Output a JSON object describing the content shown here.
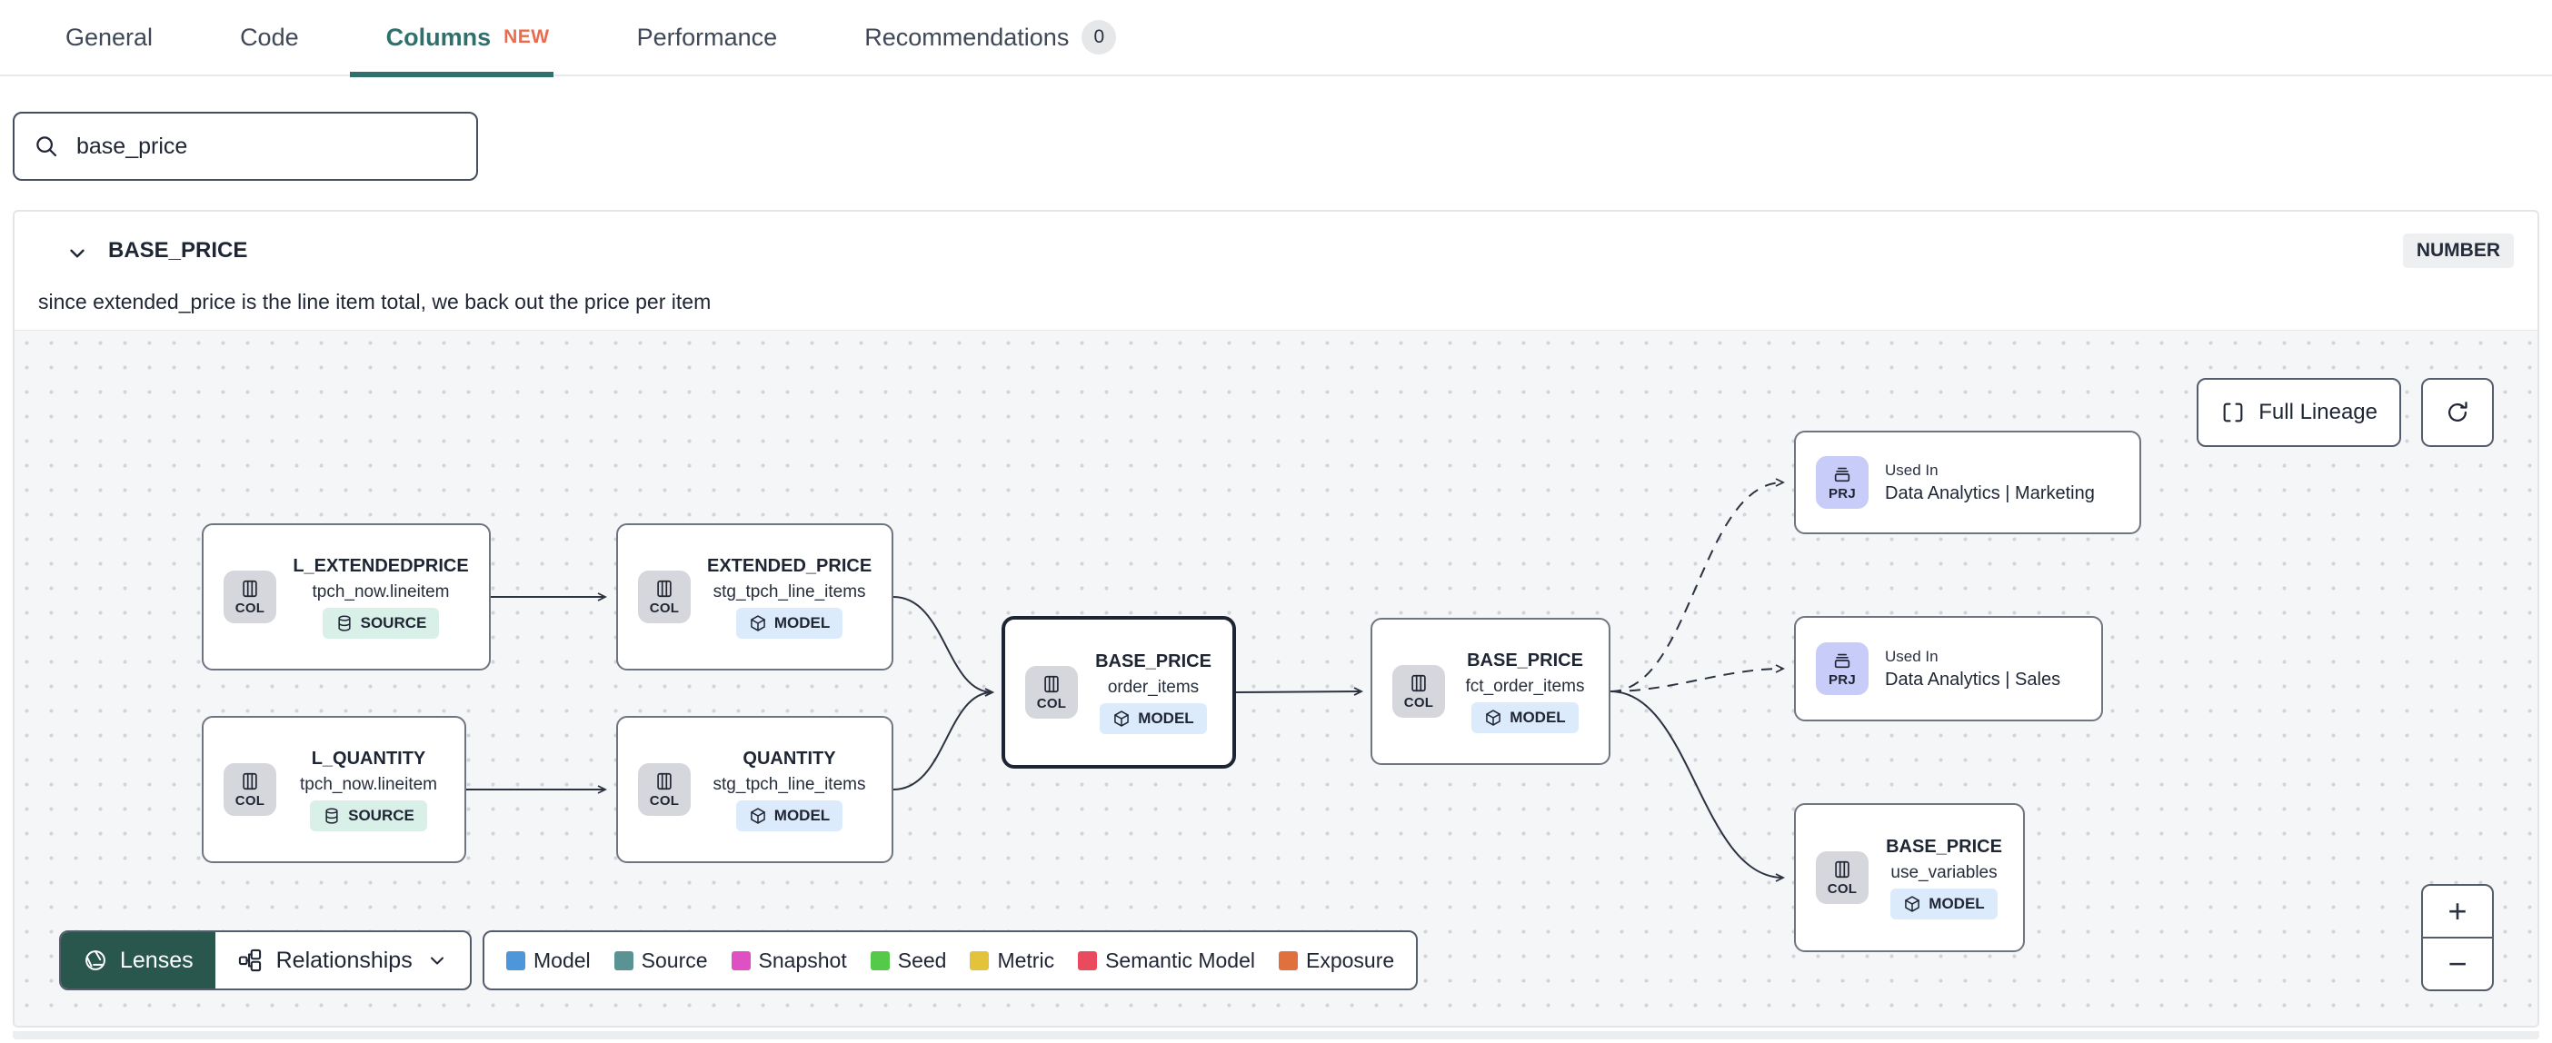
{
  "tabs": {
    "items": [
      {
        "label": "General"
      },
      {
        "label": "Code"
      },
      {
        "label": "Columns",
        "badge": "NEW"
      },
      {
        "label": "Performance"
      },
      {
        "label": "Recommendations",
        "count": "0"
      }
    ]
  },
  "search": {
    "value": "base_price"
  },
  "column": {
    "name": "BASE_PRICE",
    "type": "NUMBER",
    "description": "since extended_price is the line item total, we back out the price per item"
  },
  "lineage": {
    "full_lineage_label": "Full Lineage",
    "nodes": [
      {
        "title": "L_EXTENDEDPRICE",
        "subtitle": "tpch_now.lineitem",
        "chip": "COL",
        "badge": "SOURCE"
      },
      {
        "title": "EXTENDED_PRICE",
        "subtitle": "stg_tpch_line_items",
        "chip": "COL",
        "badge": "MODEL"
      },
      {
        "title": "L_QUANTITY",
        "subtitle": "tpch_now.lineitem",
        "chip": "COL",
        "badge": "SOURCE"
      },
      {
        "title": "QUANTITY",
        "subtitle": "stg_tpch_line_items",
        "chip": "COL",
        "badge": "MODEL"
      },
      {
        "title": "BASE_PRICE",
        "subtitle": "order_items",
        "chip": "COL",
        "badge": "MODEL"
      },
      {
        "title": "BASE_PRICE",
        "subtitle": "fct_order_items",
        "chip": "COL",
        "badge": "MODEL"
      },
      {
        "label": "Used In",
        "title": "Data Analytics | Marketing",
        "chip": "PRJ"
      },
      {
        "label": "Used In",
        "title": "Data Analytics | Sales",
        "chip": "PRJ"
      },
      {
        "title": "BASE_PRICE",
        "subtitle": "use_variables",
        "chip": "COL",
        "badge": "MODEL"
      }
    ],
    "toolbar": {
      "lenses": "Lenses",
      "relationships": "Relationships"
    },
    "legend": [
      {
        "label": "Model",
        "color": "#4d96da"
      },
      {
        "label": "Source",
        "color": "#5b9394"
      },
      {
        "label": "Snapshot",
        "color": "#df51c2"
      },
      {
        "label": "Seed",
        "color": "#54c94a"
      },
      {
        "label": "Metric",
        "color": "#e3c33c"
      },
      {
        "label": "Semantic Model",
        "color": "#e94a5d"
      },
      {
        "label": "Exposure",
        "color": "#e0703d"
      }
    ],
    "zoom_controls": {
      "zoom_in": "+",
      "zoom_out": "−"
    }
  },
  "colors": {
    "accent_teal": "#2f706d",
    "new_badge": "#ed6a4e",
    "lenses_green": "#2a574d"
  }
}
